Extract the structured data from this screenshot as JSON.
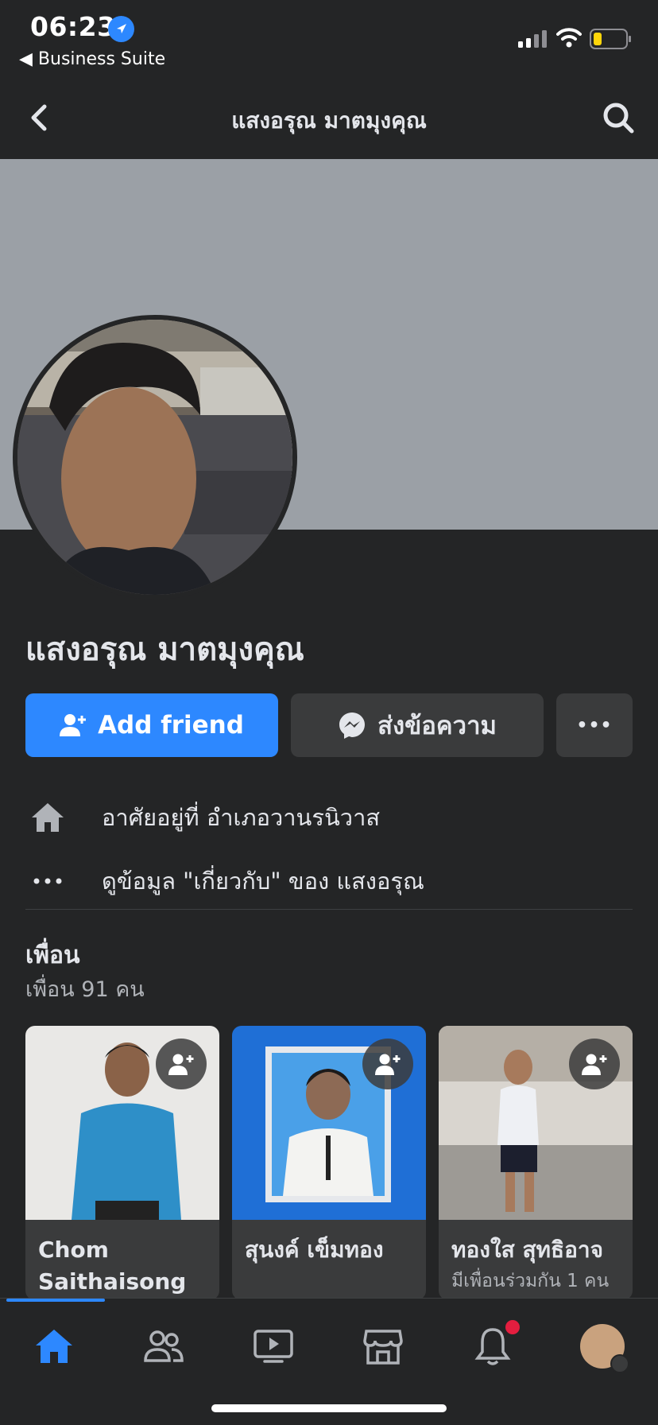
{
  "status_bar": {
    "time": "06:23",
    "back_app": "◀ Business Suite",
    "battery_level": 0.2
  },
  "header": {
    "title": "แสงอรุณ มาตมุงคุณ"
  },
  "profile": {
    "name": "แสงอรุณ มาตมุงคุณ"
  },
  "actions": {
    "add_friend": "Add friend",
    "message": "ส่งข้อความ",
    "more": "•••"
  },
  "info": {
    "lives_in": "อาศัยอยู่ที่ อำเภอวานรนิวาส",
    "about": "ดูข้อมูล \"เกี่ยวกับ\" ของ แสงอรุณ"
  },
  "friends": {
    "title": "เพื่อน",
    "count_text": "เพื่อน 91 คน",
    "cards": [
      {
        "name": "Chom Saithaisong",
        "mutual": ""
      },
      {
        "name": "สุนงค์ เข็มทอง",
        "mutual": ""
      },
      {
        "name": "ทองใส สุทธิอาจ",
        "mutual": "มีเพื่อนร่วมกัน 1 คน"
      }
    ]
  },
  "tabbar": {
    "items": [
      "home-icon",
      "friends-icon",
      "watch-icon",
      "marketplace-icon",
      "notifications-icon",
      "profile-menu-icon"
    ],
    "active": "home-icon",
    "accent": "#2d88ff",
    "badge_color": "#e41e3f"
  }
}
